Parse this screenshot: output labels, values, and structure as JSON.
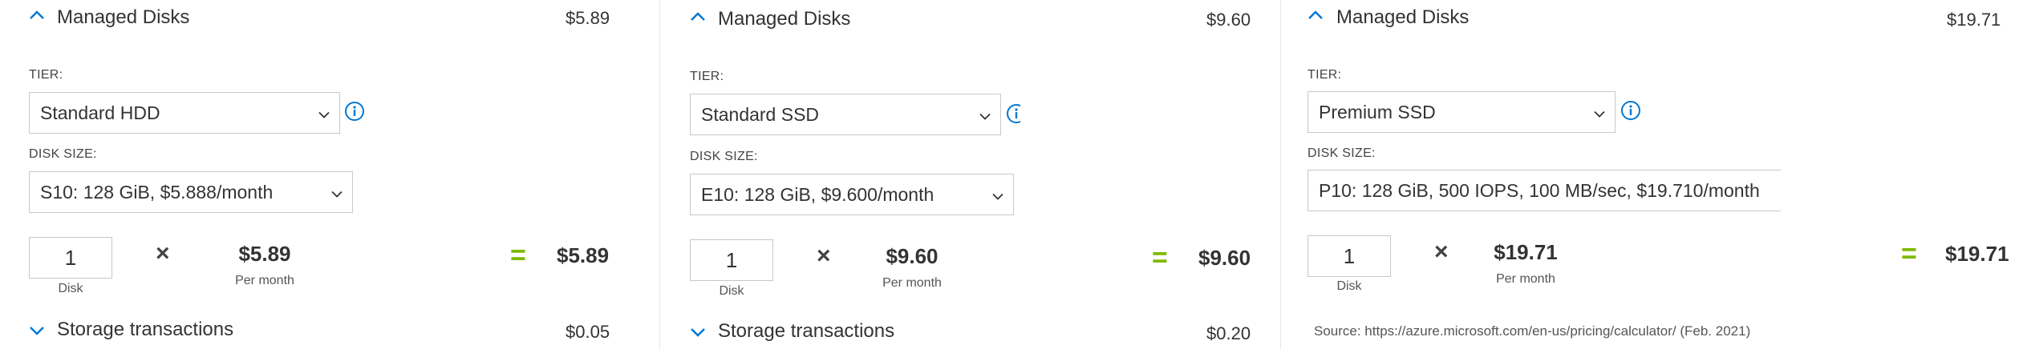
{
  "accent_color": "#0078d4",
  "equals_color": "#7fba00",
  "panels": [
    {
      "header": {
        "title": "Managed Disks",
        "price": "$5.89",
        "icon": "chevron-up-icon"
      },
      "tier": {
        "label": "TIER:",
        "value": "Standard HDD"
      },
      "disk_size": {
        "label": "DISK SIZE:",
        "value": "S10: 128 GiB, $5.888/month"
      },
      "calc": {
        "qty": "1",
        "qty_unit": "Disk",
        "times": "×",
        "unit_price": "$5.89",
        "per": "Per month",
        "equals": "=",
        "total": "$5.89"
      },
      "footer": {
        "title": "Storage transactions",
        "price": "$0.05",
        "icon": "chevron-down-icon"
      }
    },
    {
      "header": {
        "title": "Managed Disks",
        "price": "$9.60",
        "icon": "chevron-up-icon"
      },
      "tier": {
        "label": "TIER:",
        "value": "Standard SSD"
      },
      "disk_size": {
        "label": "DISK SIZE:",
        "value": "E10: 128 GiB, $9.600/month"
      },
      "calc": {
        "qty": "1",
        "qty_unit": "Disk",
        "times": "×",
        "unit_price": "$9.60",
        "per": "Per month",
        "equals": "=",
        "total": "$9.60"
      },
      "footer": {
        "title": "Storage transactions",
        "price": "$0.20",
        "icon": "chevron-down-icon"
      }
    },
    {
      "header": {
        "title": "Managed Disks",
        "price": "$19.71",
        "icon": "chevron-up-icon"
      },
      "tier": {
        "label": "TIER:",
        "value": "Premium SSD"
      },
      "disk_size": {
        "label": "DISK SIZE:",
        "value": "P10: 128 GiB, 500 IOPS, 100 MB/sec, $19.710/month"
      },
      "calc": {
        "qty": "1",
        "qty_unit": "Disk",
        "times": "×",
        "unit_price": "$19.71",
        "per": "Per month",
        "equals": "=",
        "total": "$19.71"
      },
      "source": "Source: https://azure.microsoft.com/en-us/pricing/calculator/ (Feb. 2021)"
    }
  ]
}
